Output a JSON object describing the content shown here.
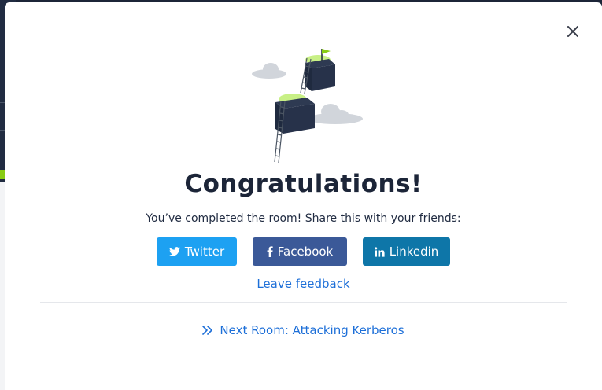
{
  "modal": {
    "title": "Congratulations!",
    "subtitle": "You’ve completed the room! Share this with your friends:",
    "close_icon": "close-icon"
  },
  "share": {
    "twitter_label": "Twitter",
    "facebook_label": "Facebook",
    "linkedin_label": "Linkedin",
    "colors": {
      "twitter": "#1da1f2",
      "facebook": "#3b5998",
      "linkedin": "#0e76a8"
    }
  },
  "feedback": {
    "label": "Leave feedback"
  },
  "next_room": {
    "label": "Next Room: Attacking Kerberos",
    "icon": "double-chevron-right-icon"
  },
  "colors": {
    "link": "#1d6fd8",
    "accent_green": "#88cc14",
    "dark": "#1c2538"
  }
}
